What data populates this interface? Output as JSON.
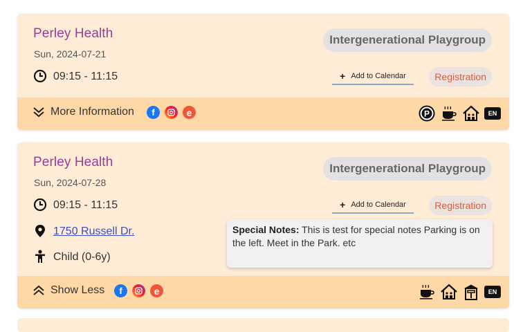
{
  "events": [
    {
      "organization": "Perley Health",
      "date": "Sun, 2024-07-21",
      "tag": "Intergenerational Playgroup",
      "time": "09:15 - 11:15",
      "add_to_calendar": "Add to Calendar",
      "registration": "Registration",
      "toggle_label": "More Information",
      "socials": [
        "facebook-icon",
        "instagram-icon",
        "eventbrite-icon"
      ],
      "amenities": [
        "parking-icon",
        "coffee-icon",
        "indoor-playground-icon",
        "language-badge"
      ],
      "language": "EN"
    },
    {
      "organization": "Perley Health",
      "date": "Sun, 2024-07-28",
      "tag": "Intergenerational Playgroup",
      "time": "09:15 - 11:15",
      "address": "1750 Russell Dr.",
      "age_group": "Child (0-6y)",
      "add_to_calendar": "Add to Calendar",
      "registration": "Registration",
      "special_notes_label": "Special Notes:",
      "special_notes_text": "This is test for special notes Parking is on the left. Meet in the Park. etc",
      "toggle_label": "Show Less",
      "socials": [
        "facebook-icon",
        "instagram-icon",
        "eventbrite-icon"
      ],
      "amenities": [
        "coffee-icon",
        "indoor-playground-icon",
        "outdoor-shelter-icon",
        "language-badge"
      ],
      "language": "EN"
    }
  ],
  "colors": {
    "card_bg": "#ffecd6",
    "footer_bg": "#ffd8a8",
    "org_title": "#953e96",
    "registration": "#e05a35",
    "tag_bg": "#e4e1e4"
  }
}
